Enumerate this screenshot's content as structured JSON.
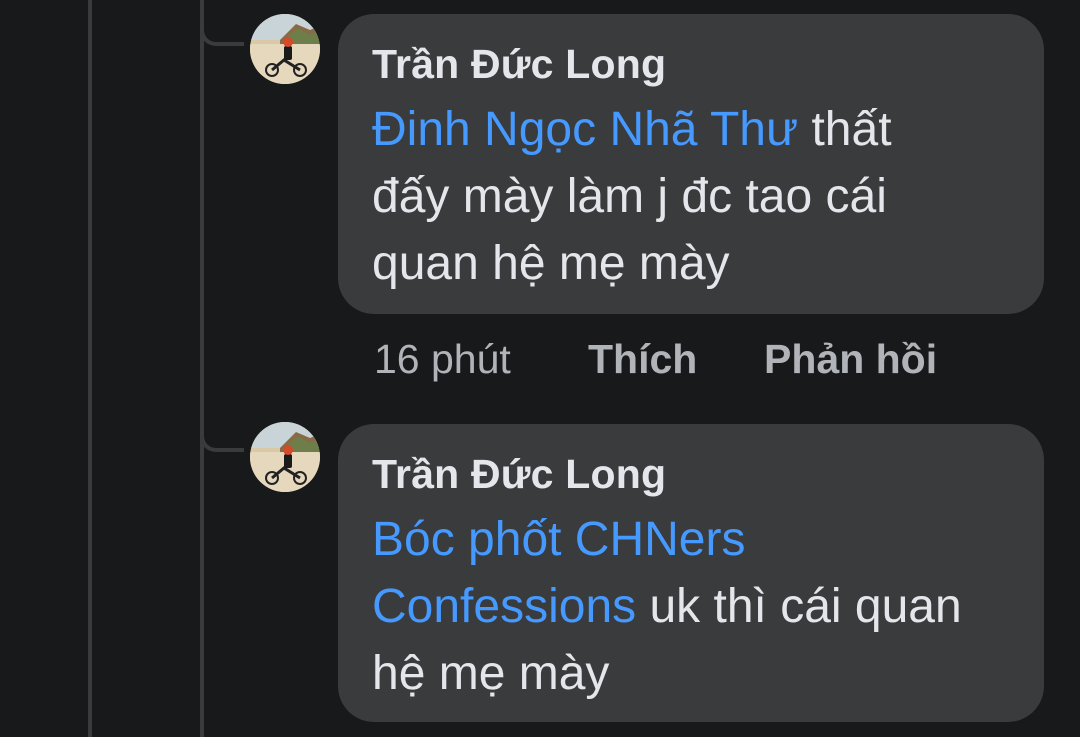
{
  "comments": [
    {
      "author": "Trần Đức Long",
      "mention": "Đinh Ngọc Nhã Thư",
      "text": " thất đấy mày làm j đc tao cái quan hệ mẹ mày",
      "time": "16 phút",
      "like_label": "Thích",
      "reply_label": "Phản hồi"
    },
    {
      "author": "Trần Đức Long",
      "mention": "Bóc phốt CHNers Confessions",
      "text": " uk thì cái quan hệ mẹ mày"
    }
  ],
  "colors": {
    "background": "#18191a",
    "bubble": "#3a3b3c",
    "mention": "#4599ff",
    "text": "#e4e6eb",
    "muted": "#b0b3b8"
  },
  "icons": {
    "avatar": "profile-photo-motorbike"
  }
}
